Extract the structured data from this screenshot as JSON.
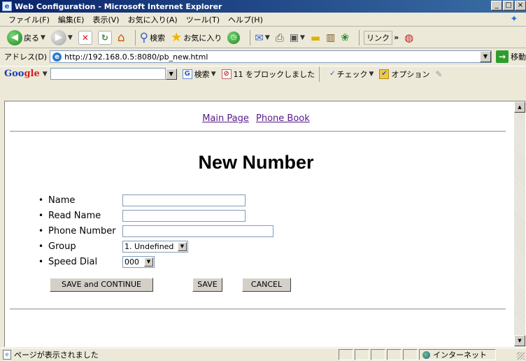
{
  "window": {
    "title": "Web Configuration - Microsoft Internet Explorer",
    "min_glyph": "_",
    "max_glyph": "□",
    "close_glyph": "×"
  },
  "menubar": {
    "items": [
      "ファイル(F)",
      "編集(E)",
      "表示(V)",
      "お気に入り(A)",
      "ツール(T)",
      "ヘルプ(H)"
    ]
  },
  "toolbar": {
    "back_label": "戻る",
    "search_label": "検索",
    "favorites_label": "お気に入り",
    "links_label": "リンク",
    "links_chevron": "»"
  },
  "address": {
    "label": "アドレス(D)",
    "url": "http://192.168.0.5:8080/pb_new.html",
    "go_label": "移動"
  },
  "googlebar": {
    "logo_g1": "Goo",
    "logo_g2": "gle",
    "search_label": "検索",
    "blocked_label": "11 をブロックしました",
    "check_label": "チェック",
    "options_label": "オプション"
  },
  "page": {
    "nav_links": [
      "Main Page",
      "Phone Book"
    ],
    "heading": "New Number",
    "fields": [
      {
        "label": "Name",
        "type": "text",
        "value": ""
      },
      {
        "label": "Read Name",
        "type": "text",
        "value": ""
      },
      {
        "label": "Phone Number",
        "type": "text",
        "value": ""
      },
      {
        "label": "Group",
        "type": "select",
        "value": "1. Undefined"
      },
      {
        "label": "Speed Dial",
        "type": "select",
        "value": "000"
      }
    ],
    "buttons": {
      "save_continue": "SAVE and CONTINUE",
      "save": "SAVE",
      "cancel": "CANCEL"
    }
  },
  "statusbar": {
    "text": "ページが表示されました",
    "zone": "インターネット"
  },
  "colors": {
    "title_bar": "#0a246a",
    "link": "#551a8b",
    "chrome": "#ece9d8"
  }
}
